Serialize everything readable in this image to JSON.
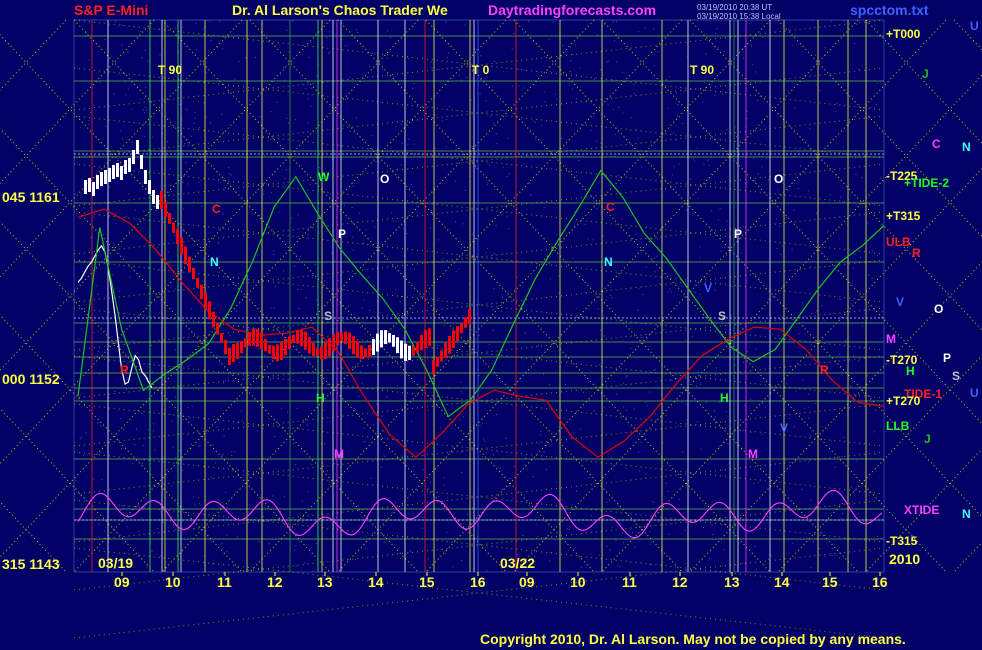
{
  "header": {
    "symbol": "S&P E-Mini",
    "title": "Dr. Al Larson's Chaos Trader We",
    "url": "Daytradingforecasts.com",
    "file": "spcctom.txt",
    "stamp1": "03/19/2010 20:38 UT",
    "stamp2": "03/19/2010 15:38 Local"
  },
  "footer": {
    "copyright": "Copyright 2010, Dr. Al Larson. May not be copied by any means."
  },
  "colors": {
    "background": "#000066",
    "price_white": "#ffffff",
    "price_red": "#ff0000",
    "green": "#20ff20",
    "red": "#e00000",
    "magenta": "#ff40ff",
    "yellow": "#ffff40",
    "grid_yellow": "#c8c800",
    "grid_green": "#40a040"
  },
  "chart_data": {
    "type": "line",
    "title": "S&P E-Mini",
    "x_axis": {
      "ticks": [
        "09",
        "10",
        "11",
        "12",
        "13",
        "14",
        "15",
        "16",
        "09",
        "10",
        "11",
        "12",
        "13",
        "14",
        "15",
        "16"
      ],
      "date_labels": [
        "03/19",
        "03/22"
      ],
      "year": "2010"
    },
    "y_axis": {
      "labels": [
        {
          "text": "045  1161",
          "value": 1161
        },
        {
          "text": "000  1152",
          "value": 1152
        },
        {
          "text": "315  1143",
          "value": 1143
        }
      ],
      "ylim": [
        1143,
        1161
      ]
    },
    "right_labels": [
      {
        "text": "+T000",
        "color": "#ffff40"
      },
      {
        "text": "-T225",
        "color": "#ffff40"
      },
      {
        "text": "+TIDE-2",
        "color": "#20ff20"
      },
      {
        "text": "+T315",
        "color": "#ffff40"
      },
      {
        "text": "ULB",
        "color": "#ff2020"
      },
      {
        "text": "M",
        "color": "#ff40ff"
      },
      {
        "text": "-T270",
        "color": "#ffff40"
      },
      {
        "text": "TIDE-1",
        "color": "#ff2020"
      },
      {
        "text": "+T270",
        "color": "#ffff40"
      },
      {
        "text": "LLB",
        "color": "#20ff20"
      },
      {
        "text": "XTIDE",
        "color": "#ff40ff"
      },
      {
        "text": "-T315",
        "color": "#ffff40"
      }
    ],
    "planet_labels": [
      {
        "text": "U",
        "color": "#4060ff"
      },
      {
        "text": "J",
        "color": "#20c020"
      },
      {
        "text": "C",
        "color": "#ff40ff"
      },
      {
        "text": "N",
        "color": "#40ffff"
      },
      {
        "text": "R",
        "color": "#ff2020"
      },
      {
        "text": "V",
        "color": "#4060ff"
      },
      {
        "text": "O",
        "color": "#ffffff"
      },
      {
        "text": "P",
        "color": "#ffffff"
      },
      {
        "text": "H",
        "color": "#20ff20"
      },
      {
        "text": "S",
        "color": "#c0c0c0"
      },
      {
        "text": "U",
        "color": "#4060ff"
      },
      {
        "text": "J",
        "color": "#20c020"
      },
      {
        "text": "N",
        "color": "#40ffff"
      }
    ],
    "time_markers": [
      {
        "text": "T  90"
      },
      {
        "text": "T  0"
      },
      {
        "text": "T  90"
      }
    ],
    "chart_letters": [
      {
        "text": "W",
        "color": "#20ff20"
      },
      {
        "text": "O",
        "color": "#ffffff"
      },
      {
        "text": "P",
        "color": "#ffffff"
      },
      {
        "text": "C",
        "color": "#ff2020"
      },
      {
        "text": "N",
        "color": "#40ffff"
      },
      {
        "text": "S",
        "color": "#c0c0c0"
      },
      {
        "text": "H",
        "color": "#20ff20"
      },
      {
        "text": "M",
        "color": "#ff40ff"
      },
      {
        "text": "R",
        "color": "#ff2020"
      },
      {
        "text": "C",
        "color": "#ff2020"
      },
      {
        "text": "N",
        "color": "#40ffff"
      },
      {
        "text": "O",
        "color": "#ffffff"
      },
      {
        "text": "P",
        "color": "#ffffff"
      },
      {
        "text": "V",
        "color": "#4060ff"
      },
      {
        "text": "S",
        "color": "#c0c0c0"
      },
      {
        "text": "H",
        "color": "#20ff20"
      },
      {
        "text": "M",
        "color": "#ff40ff"
      },
      {
        "text": "V",
        "color": "#4060ff"
      },
      {
        "text": "R",
        "color": "#ff2020"
      }
    ],
    "series": [
      {
        "color": "#ffffff",
        "values": [
          1156.8,
          1157.0,
          1157.3,
          1157.6,
          1157.8,
          1158.1,
          1158.4,
          1158.6,
          1158.3,
          1157.5,
          1156.4,
          1155.2,
          1153.8,
          1152.5,
          1151.8,
          1151.9,
          1152.6,
          1153.2,
          1153.0,
          1152.4,
          1152.2,
          1151.9,
          1151.6
        ]
      },
      {
        "color": "#20c020",
        "values": [
          1151.2,
          1159.5,
          1154.5,
          1151.5,
          1152.3,
          1153.0,
          1153.8,
          1155.5,
          1157.8,
          1160.5,
          1162.0,
          1160.2,
          1158.5,
          1157.2,
          1156.0,
          1154.5,
          1152.5,
          1150.2,
          1151.0,
          1152.5,
          1154.8,
          1157.0,
          1158.8,
          1160.5,
          1162.3,
          1161.0,
          1159.2,
          1158.0,
          1156.5,
          1155.0,
          1153.6,
          1152.9,
          1153.5,
          1155.0,
          1156.5,
          1157.8,
          1158.6,
          1159.6
        ]
      },
      {
        "color": "#e00000",
        "values": [
          1160.0,
          1160.4,
          1159.7,
          1158.4,
          1156.8,
          1155.4,
          1154.5,
          1154.2,
          1154.3,
          1154.6,
          1153.4,
          1151.2,
          1149.3,
          1148.2,
          1149.4,
          1150.8,
          1151.5,
          1151.2,
          1151.0,
          1149.2,
          1148.2,
          1149.0,
          1150.2,
          1151.8,
          1153.2,
          1154.0,
          1154.6,
          1154.5,
          1153.5,
          1152.0,
          1150.9,
          1150.7
        ]
      }
    ]
  }
}
